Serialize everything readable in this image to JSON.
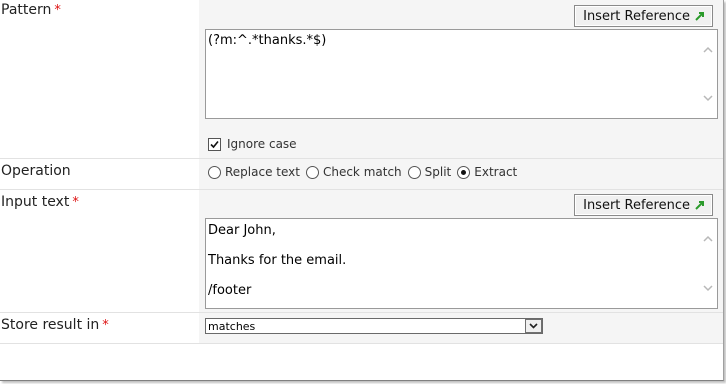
{
  "pattern": {
    "label": "Pattern",
    "required_marker": "*",
    "insert_button": "Insert Reference",
    "value": "(?m:^.*thanks.*$)",
    "ignore_case_label": "Ignore case",
    "ignore_case_checked": true
  },
  "operation": {
    "label": "Operation",
    "options": [
      "Replace text",
      "Check match",
      "Split",
      "Extract"
    ],
    "selected": "Extract"
  },
  "input_text": {
    "label": "Input text",
    "required_marker": "*",
    "insert_button": "Insert Reference",
    "lines": [
      "Dear John,",
      "Thanks for the email.",
      "/footer"
    ]
  },
  "store_result": {
    "label": "Store result in",
    "required_marker": "*",
    "value": "matches"
  }
}
